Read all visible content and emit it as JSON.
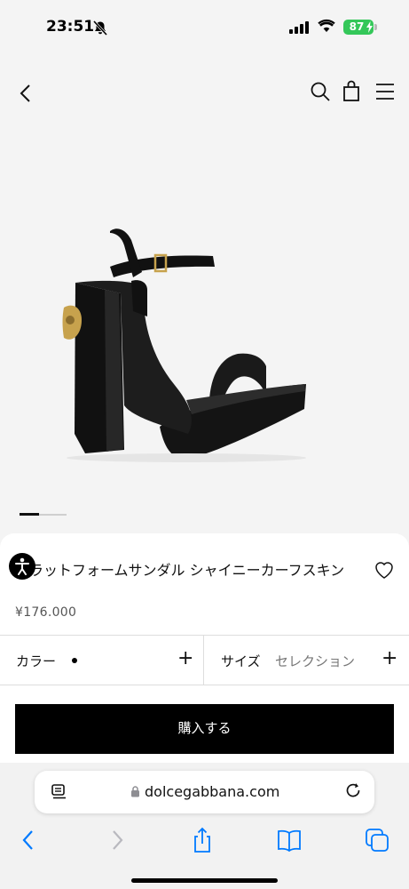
{
  "status_bar": {
    "time": "23:51",
    "battery": "87"
  },
  "header": {
    "icons": [
      "chevron-left-icon",
      "search-icon",
      "shopping-bag-icon",
      "menu-icon"
    ]
  },
  "product": {
    "name": "プラットフォームサンダル シャイニーカーフスキン",
    "price": "¥176.000",
    "color_label": "カラー",
    "selected_color": "#000000",
    "size_label": "サイズ",
    "size_value": "セレクション",
    "buy_label": "購入する"
  },
  "browser": {
    "url": "dolcegabbana.com",
    "icons": [
      "reader-icon",
      "lock-icon",
      "reload-icon",
      "back-icon",
      "forward-icon",
      "share-icon",
      "bookmarks-icon",
      "tabs-icon"
    ]
  },
  "colors": {
    "accent": "#007aff",
    "battery": "#34c759",
    "buy_button": "#000000"
  }
}
